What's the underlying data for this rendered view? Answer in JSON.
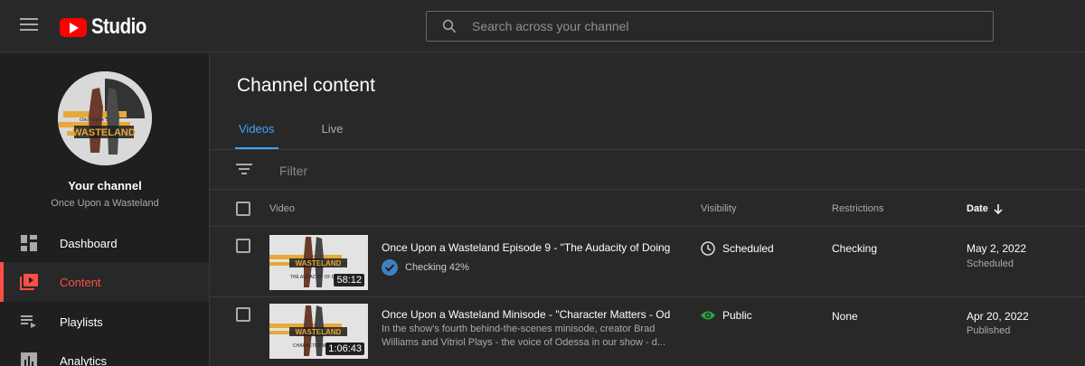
{
  "app": {
    "studio_label": "Studio"
  },
  "search": {
    "placeholder": "Search across your channel"
  },
  "sidebar": {
    "channel_title": "Your channel",
    "channel_name": "Once Upon a Wasteland",
    "items": [
      {
        "label": "Dashboard",
        "icon": "dashboard-icon"
      },
      {
        "label": "Content",
        "icon": "content-icon",
        "active": true
      },
      {
        "label": "Playlists",
        "icon": "playlists-icon"
      },
      {
        "label": "Analytics",
        "icon": "analytics-icon"
      }
    ]
  },
  "main": {
    "title": "Channel content",
    "tabs": [
      {
        "label": "Videos",
        "active": true
      },
      {
        "label": "Live"
      }
    ],
    "filter_label": "Filter",
    "columns": {
      "video": "Video",
      "visibility": "Visibility",
      "restrictions": "Restrictions",
      "date": "Date"
    },
    "rows": [
      {
        "title": "Once Upon a Wasteland Episode 9 - \"The Audacity of Doing...",
        "status": "Checking 42%",
        "duration": "58:12",
        "visibility": "Scheduled",
        "visibility_icon": "clock-icon",
        "restrictions": "Checking",
        "date": "May 2, 2022",
        "date_status": "Scheduled"
      },
      {
        "title": "Once Upon a Wasteland Minisode - \"Character Matters - Od...",
        "description": "In the show's fourth behind-the-scenes minisode, creator Brad Williams and Vitriol Plays - the voice of Odessa in our show - d...",
        "duration": "1:06:43",
        "visibility": "Public",
        "visibility_icon": "eye-icon",
        "restrictions": "None",
        "date": "Apr 20, 2022",
        "date_status": "Published"
      }
    ]
  },
  "colors": {
    "accent_red": "#ff4e45",
    "tab_blue": "#3ea6ff",
    "public_green": "#2ba640",
    "check_blue": "#3b82c4"
  }
}
